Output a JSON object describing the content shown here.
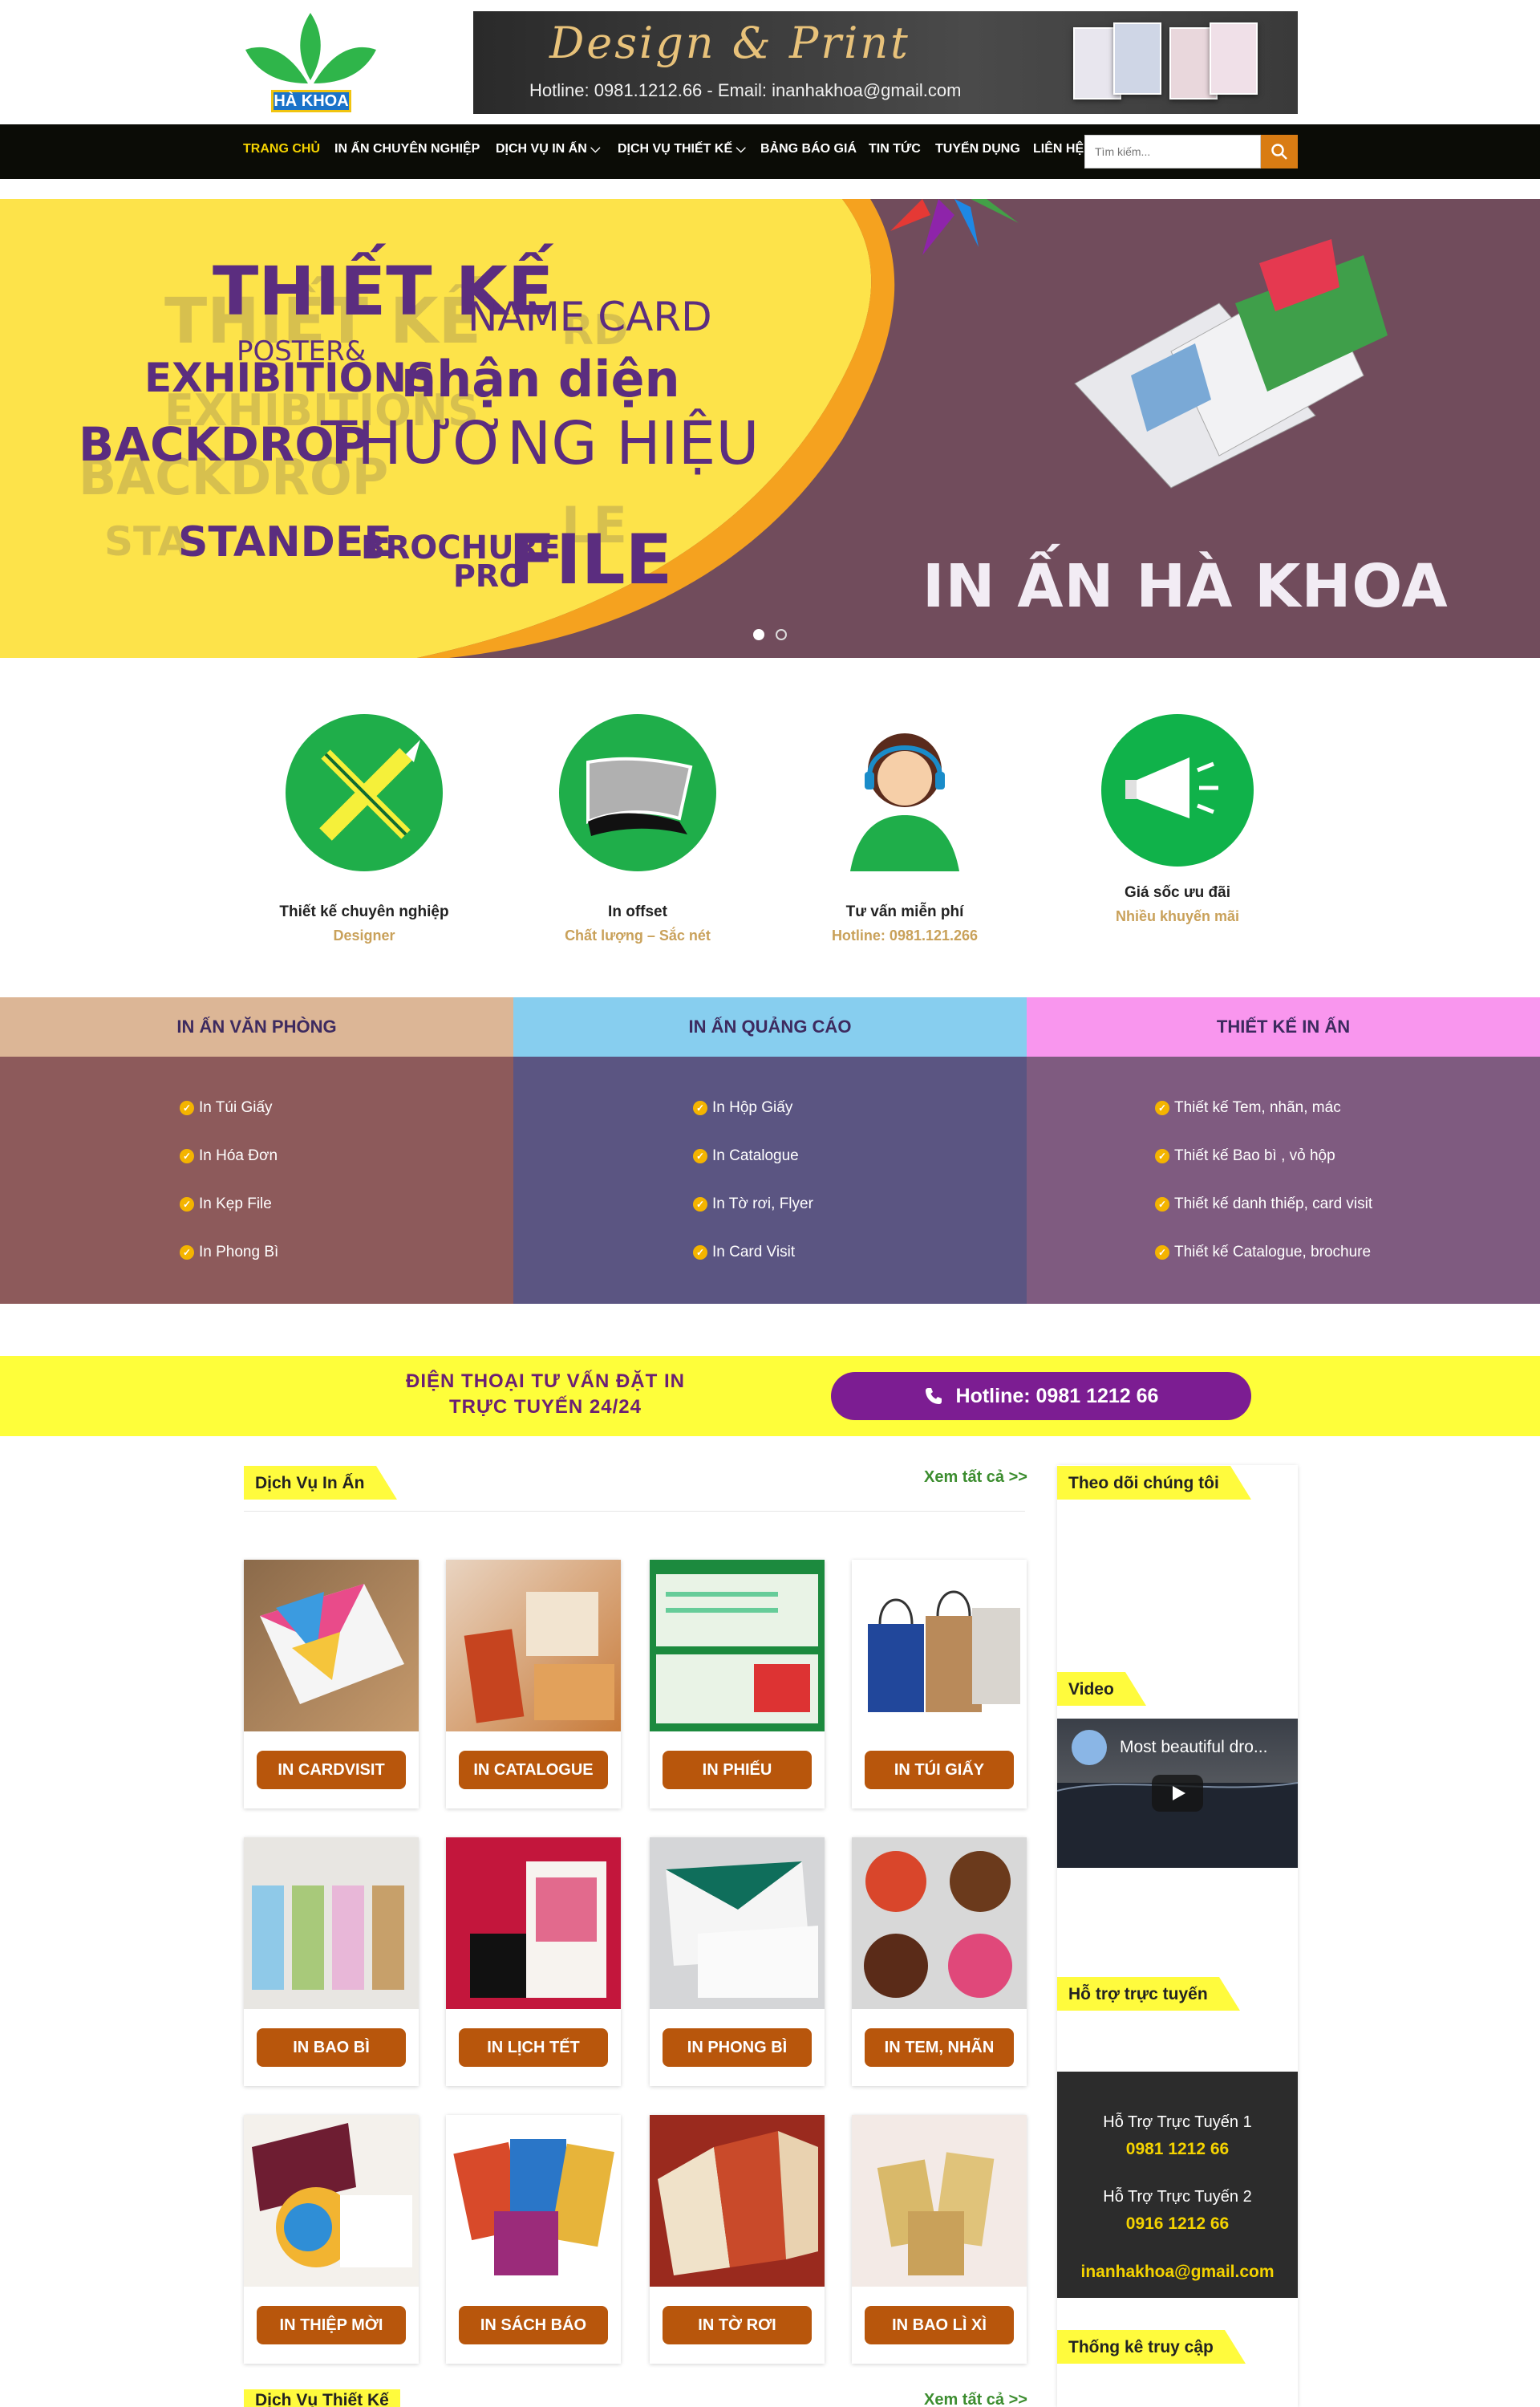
{
  "header": {
    "logo_text": "HÀ KHOA",
    "banner_title": "Design & Print",
    "banner_contact": "Hotline: 0981.1212.66 - Email: inanhakhoa@gmail.com"
  },
  "nav": {
    "items": [
      {
        "label": "TRANG CHỦ"
      },
      {
        "label": "IN ẤN CHUYÊN NGHIỆP"
      },
      {
        "label": "DỊCH VỤ IN ẤN ⌵"
      },
      {
        "label": "DỊCH VỤ THIẾT KẾ ⌵"
      },
      {
        "label": "BẢNG BÁO GIÁ"
      },
      {
        "label": "TIN TỨC"
      },
      {
        "label": "TUYỂN DỤNG"
      },
      {
        "label": "LIÊN HỆ"
      }
    ],
    "search_placeholder": "Tìm kiếm..."
  },
  "hero": {
    "words": [
      "THIẾT KẾ",
      "NAME CARD",
      "POSTER&",
      "EXHIBITIONS",
      "nhận diện",
      "BACKDROP",
      "THƯƠNG HIỆU",
      "STANDEE",
      "BROCHURE",
      "PRO",
      "FILE"
    ],
    "brand": "IN ẤN HÀ KHOA"
  },
  "features": [
    {
      "title": "Thiết kế chuyên nghiệp",
      "subtitle": "Designer",
      "icon": "pencil-brush-icon"
    },
    {
      "title": "In offset",
      "subtitle": "Chất lượng – Sắc nét",
      "icon": "paper-stack-icon"
    },
    {
      "title": "Tư vấn miễn phí",
      "subtitle": "Hotline: 0981.121.266",
      "icon": "support-agent-icon"
    },
    {
      "title": "Giá sốc ưu đãi",
      "subtitle": "Nhiều khuyến mãi",
      "icon": "megaphone-icon"
    }
  ],
  "categories": [
    {
      "title": "IN ẤN VĂN PHÒNG",
      "head_color": "#dcb696",
      "body_color": "#8d5a5b",
      "items": [
        "In Túi Giấy",
        "In Hóa Đơn",
        "In Kẹp File",
        "In Phong Bì"
      ]
    },
    {
      "title": "IN ẤN QUẢNG CÁO",
      "head_color": "#87ceef",
      "body_color": "#5b5582",
      "items": [
        "In Hộp Giấy",
        "In Catalogue",
        "In Tờ rơi, Flyer",
        "In Card Visit"
      ]
    },
    {
      "title": "THIẾT KẾ IN ẤN",
      "head_color": "#f996ee",
      "body_color": "#7f5b80",
      "items": [
        "Thiết kế Tem, nhãn, mác",
        "Thiết kế Bao bì , vỏ hộp",
        "Thiết kế danh thiếp, card visit",
        "Thiết kế Catalogue, brochure"
      ]
    }
  ],
  "hotline_band": {
    "text_line1": "ĐIỆN THOẠI TƯ VẤN ĐẶT IN",
    "text_line2": "TRỰC TUYẾN 24/24",
    "button": "Hotline: 0981 1212 66"
  },
  "services": {
    "title": "Dịch Vụ In Ấn",
    "view_all": "Xem tất cả >>",
    "products": [
      {
        "label": "IN CARDVISIT"
      },
      {
        "label": "IN CATALOGUE"
      },
      {
        "label": "IN PHIẾU"
      },
      {
        "label": "IN TÚI GIẤY"
      },
      {
        "label": "IN BAO BÌ"
      },
      {
        "label": "IN LỊCH TẾT"
      },
      {
        "label": "IN PHONG BÌ"
      },
      {
        "label": "IN TEM, NHÃN"
      },
      {
        "label": "IN THIỆP MỜI"
      },
      {
        "label": "IN SÁCH BÁO"
      },
      {
        "label": "IN TỜ RƠI"
      },
      {
        "label": "IN BAO LÌ XÌ"
      }
    ]
  },
  "design_services": {
    "title": "Dịch Vụ Thiết Kế",
    "view_all": "Xem tất cả >>"
  },
  "sidebar": {
    "follow_title": "Theo dõi chúng tôi",
    "video_title": "Video",
    "video_caption": "Most beautiful dro...",
    "support_title": "Hỗ trợ trực tuyến",
    "support": [
      {
        "label": "Hỗ Trợ Trực Tuyến 1",
        "phone": "0981 1212 66"
      },
      {
        "label": "Hỗ Trợ Trực Tuyến 2",
        "phone": "0916 1212 66"
      }
    ],
    "email": "inanhakhoa@gmail.com",
    "stats_title": "Thống kê truy cập"
  }
}
